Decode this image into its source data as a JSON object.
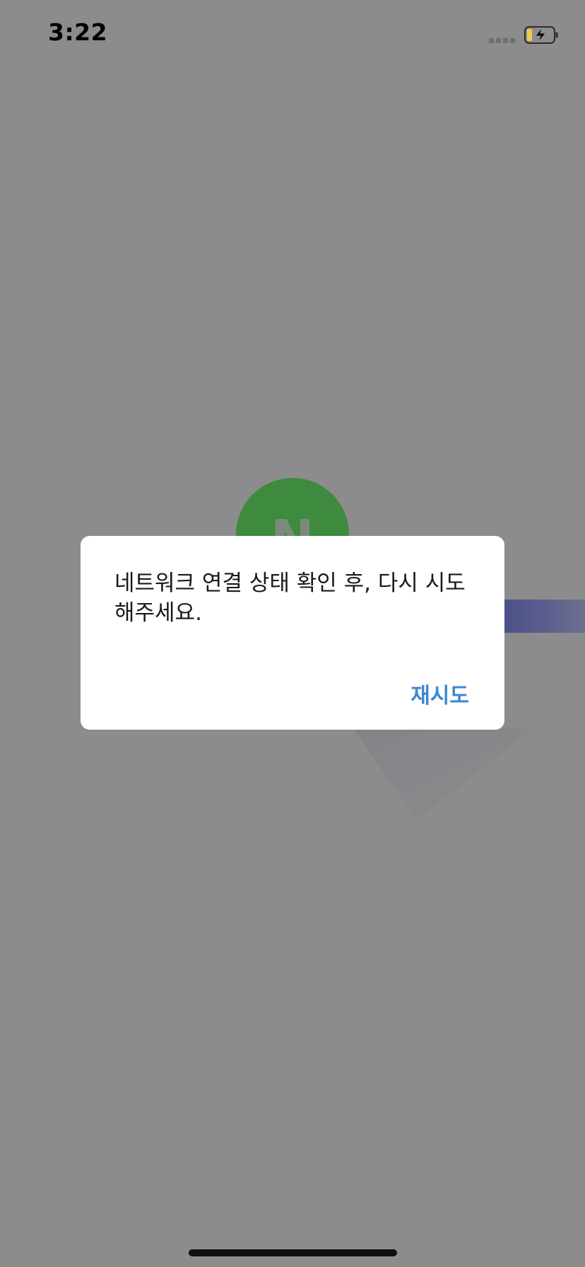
{
  "status_bar": {
    "time": "3:22",
    "signal_icon": "cellular-signal-icon",
    "battery_icon": "battery-charging-icon",
    "battery_color": "#f2c94c"
  },
  "splash": {
    "logo_icon": "naver-n-logo-icon",
    "logo_letter": "N",
    "logo_color": "#3e8a3e",
    "band_color": "#4a4d88"
  },
  "alert": {
    "message": "네트워크 연결 상태 확인 후, 다시 시도해주세요.",
    "retry_label": "재시도",
    "accent_color": "#3d86d6"
  }
}
